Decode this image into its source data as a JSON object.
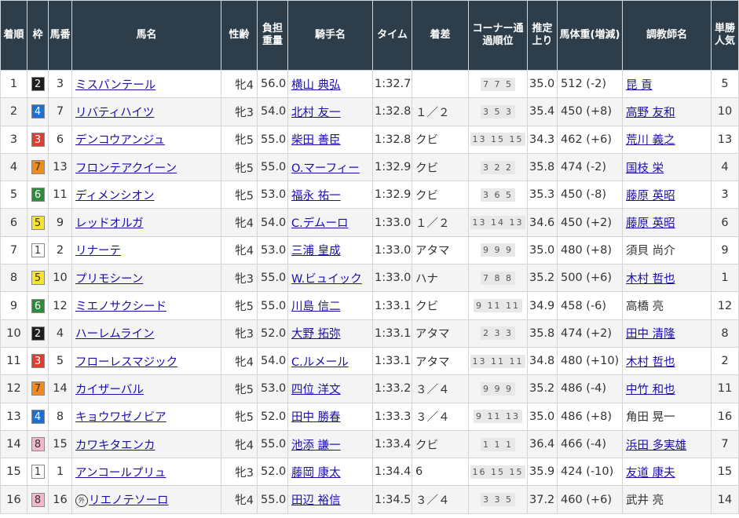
{
  "headers": {
    "rank": "着順",
    "waku": "枠",
    "umaban": "馬番",
    "horse": "馬名",
    "sex_age": "性齢",
    "weight_carried": "負担重量",
    "jockey": "騎手名",
    "time": "タイム",
    "margin": "着差",
    "corner": "コーナー通過順位",
    "last3f": "推定上り",
    "body_weight": "馬体重(増減)",
    "trainer": "調教師名",
    "popularity": "単勝人気"
  },
  "waku_colors": {
    "1": {
      "bg": "#ffffff",
      "fg": "#333333"
    },
    "2": {
      "bg": "#1e1e1e",
      "fg": "#ffffff"
    },
    "3": {
      "bg": "#e03c31",
      "fg": "#ffffff"
    },
    "4": {
      "bg": "#1f6fd1",
      "fg": "#ffffff"
    },
    "5": {
      "bg": "#f6e52e",
      "fg": "#333333"
    },
    "6": {
      "bg": "#2e8b3a",
      "fg": "#ffffff"
    },
    "7": {
      "bg": "#f08c1e",
      "fg": "#333333"
    },
    "8": {
      "bg": "#f5b8c8",
      "fg": "#333333"
    }
  },
  "rows": [
    {
      "rank": "1",
      "waku": "2",
      "umaban": "3",
      "horse": "ミスパンテール",
      "sex_age": "牝4",
      "weight": "56.0",
      "jockey": "横山 典弘",
      "time": "1:32.7",
      "margin": "",
      "corner": "7 7 5",
      "last3f": "35.0",
      "body_weight": "512 (-2)",
      "trainer": "昆 貢",
      "trainer_link": true,
      "pop": "5"
    },
    {
      "rank": "2",
      "waku": "4",
      "umaban": "7",
      "horse": "リバティハイツ",
      "sex_age": "牝3",
      "weight": "54.0",
      "jockey": "北村 友一",
      "time": "1:32.8",
      "margin": "１／２",
      "corner": "3 5 3",
      "last3f": "35.4",
      "body_weight": "450 (+8)",
      "trainer": "高野 友和",
      "trainer_link": true,
      "pop": "10"
    },
    {
      "rank": "3",
      "waku": "3",
      "umaban": "6",
      "horse": "デンコウアンジュ",
      "sex_age": "牝5",
      "weight": "55.0",
      "jockey": "柴田 善臣",
      "time": "1:32.8",
      "margin": "クビ",
      "corner": "13 15 15",
      "last3f": "34.3",
      "body_weight": "462 (+6)",
      "trainer": "荒川 義之",
      "trainer_link": true,
      "pop": "13"
    },
    {
      "rank": "4",
      "waku": "7",
      "umaban": "13",
      "horse": "フロンテアクイーン",
      "sex_age": "牝5",
      "weight": "55.0",
      "jockey": "O.マーフィー",
      "time": "1:32.9",
      "margin": "クビ",
      "corner": "3 2 2",
      "last3f": "35.8",
      "body_weight": "474 (-2)",
      "trainer": "国枝 栄",
      "trainer_link": true,
      "pop": "4"
    },
    {
      "rank": "5",
      "waku": "6",
      "umaban": "11",
      "horse": "ディメンシオン",
      "sex_age": "牝5",
      "weight": "53.0",
      "jockey": "福永 祐一",
      "time": "1:32.9",
      "margin": "クビ",
      "corner": "3 6 5",
      "last3f": "35.3",
      "body_weight": "450 (-8)",
      "trainer": "藤原 英昭",
      "trainer_link": true,
      "pop": "3"
    },
    {
      "rank": "6",
      "waku": "5",
      "umaban": "9",
      "horse": "レッドオルガ",
      "sex_age": "牝4",
      "weight": "54.0",
      "jockey": "C.デムーロ",
      "time": "1:33.0",
      "margin": "１／２",
      "corner": "13 14 13",
      "last3f": "34.6",
      "body_weight": "450 (+2)",
      "trainer": "藤原 英昭",
      "trainer_link": true,
      "pop": "6"
    },
    {
      "rank": "7",
      "waku": "1",
      "umaban": "2",
      "horse": "リナーテ",
      "sex_age": "牝4",
      "weight": "53.0",
      "jockey": "三浦 皇成",
      "time": "1:33.0",
      "margin": "アタマ",
      "corner": "9 9 9",
      "last3f": "35.0",
      "body_weight": "480 (+8)",
      "trainer": "須貝 尚介",
      "trainer_link": false,
      "pop": "9"
    },
    {
      "rank": "8",
      "waku": "5",
      "umaban": "10",
      "horse": "プリモシーン",
      "sex_age": "牝3",
      "weight": "55.0",
      "jockey": "W.ビュイック",
      "time": "1:33.0",
      "margin": "ハナ",
      "corner": "7 8 8",
      "last3f": "35.2",
      "body_weight": "500 (+6)",
      "trainer": "木村 哲也",
      "trainer_link": true,
      "pop": "1"
    },
    {
      "rank": "9",
      "waku": "6",
      "umaban": "12",
      "horse": "ミエノサクシード",
      "sex_age": "牝5",
      "weight": "55.0",
      "jockey": "川島 信二",
      "time": "1:33.1",
      "margin": "クビ",
      "corner": "9 11 11",
      "last3f": "34.9",
      "body_weight": "458 (-6)",
      "trainer": "高橋 亮",
      "trainer_link": false,
      "pop": "12"
    },
    {
      "rank": "10",
      "waku": "2",
      "umaban": "4",
      "horse": "ハーレムライン",
      "sex_age": "牝3",
      "weight": "52.0",
      "jockey": "大野 拓弥",
      "time": "1:33.1",
      "margin": "アタマ",
      "corner": "2 3 3",
      "last3f": "35.8",
      "body_weight": "474 (+2)",
      "trainer": "田中 清隆",
      "trainer_link": true,
      "pop": "8"
    },
    {
      "rank": "11",
      "waku": "3",
      "umaban": "5",
      "horse": "フローレスマジック",
      "sex_age": "牝4",
      "weight": "54.0",
      "jockey": "C.ルメール",
      "time": "1:33.1",
      "margin": "アタマ",
      "corner": "13 11 11",
      "last3f": "34.8",
      "body_weight": "480 (+10)",
      "trainer": "木村 哲也",
      "trainer_link": true,
      "pop": "2"
    },
    {
      "rank": "12",
      "waku": "7",
      "umaban": "14",
      "horse": "カイザーバル",
      "sex_age": "牝5",
      "weight": "53.0",
      "jockey": "四位 洋文",
      "time": "1:33.2",
      "margin": "３／４",
      "corner": "9 9 9",
      "last3f": "35.2",
      "body_weight": "486 (-4)",
      "trainer": "中竹 和也",
      "trainer_link": true,
      "pop": "11"
    },
    {
      "rank": "13",
      "waku": "4",
      "umaban": "8",
      "horse": "キョウワゼノビア",
      "sex_age": "牝5",
      "weight": "52.0",
      "jockey": "田中 勝春",
      "time": "1:33.3",
      "margin": "３／４",
      "corner": "9 11 13",
      "last3f": "35.0",
      "body_weight": "486 (+8)",
      "trainer": "角田 晃一",
      "trainer_link": false,
      "pop": "16"
    },
    {
      "rank": "14",
      "waku": "8",
      "umaban": "15",
      "horse": "カワキタエンカ",
      "sex_age": "牝4",
      "weight": "55.0",
      "jockey": "池添 謙一",
      "time": "1:33.4",
      "margin": "クビ",
      "corner": "1 1 1",
      "last3f": "36.4",
      "body_weight": "466 (-4)",
      "trainer": "浜田 多実雄",
      "trainer_link": true,
      "pop": "7"
    },
    {
      "rank": "15",
      "waku": "1",
      "umaban": "1",
      "horse": "アンコールプリュ",
      "sex_age": "牝3",
      "weight": "52.0",
      "jockey": "藤岡 康太",
      "time": "1:34.4",
      "margin": "6",
      "corner": "16 15 15",
      "last3f": "35.9",
      "body_weight": "424 (-10)",
      "trainer": "友道 康夫",
      "trainer_link": true,
      "pop": "15"
    },
    {
      "rank": "16",
      "waku": "8",
      "umaban": "16",
      "horse": "リエノテソーロ",
      "horse_mark": "外",
      "sex_age": "牝4",
      "weight": "55.0",
      "jockey": "田辺 裕信",
      "time": "1:34.5",
      "margin": "３／４",
      "corner": "3 3 5",
      "last3f": "37.2",
      "body_weight": "460 (+6)",
      "trainer": "武井 亮",
      "trainer_link": false,
      "pop": "14"
    }
  ]
}
